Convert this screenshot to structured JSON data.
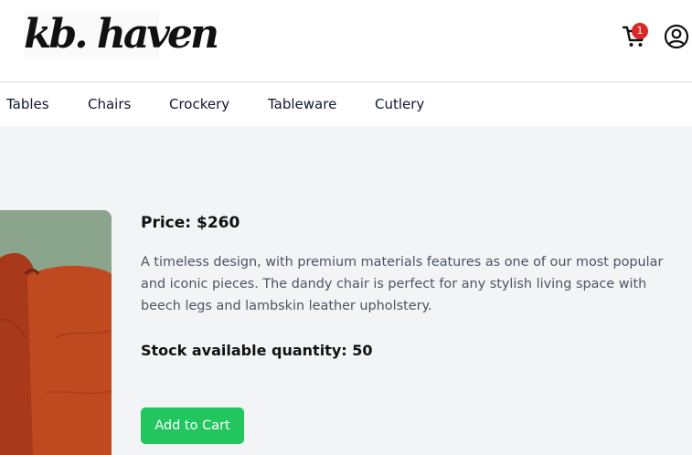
{
  "header": {
    "logo_text": "kb. haven",
    "cart_icon": "cart-icon",
    "cart_count": "1",
    "user_icon": "user-circle-icon"
  },
  "nav": {
    "items": [
      "Tables",
      "Chairs",
      "Crockery",
      "Tableware",
      "Cutlery"
    ]
  },
  "product": {
    "price_text": "Price: $260",
    "description": "A timeless design, with premium materials features as one of our most popular and iconic pieces. The dandy chair is perfect for any stylish living space with beech legs and lambskin leather upholstery.",
    "stock_text": "Stock available quantity: 50",
    "add_to_cart_label": "Add to Cart"
  },
  "colors": {
    "accent": "#22c55e",
    "badge": "#dc2626",
    "page_bg": "#f2f4f6",
    "sofa": "#b5401a"
  }
}
